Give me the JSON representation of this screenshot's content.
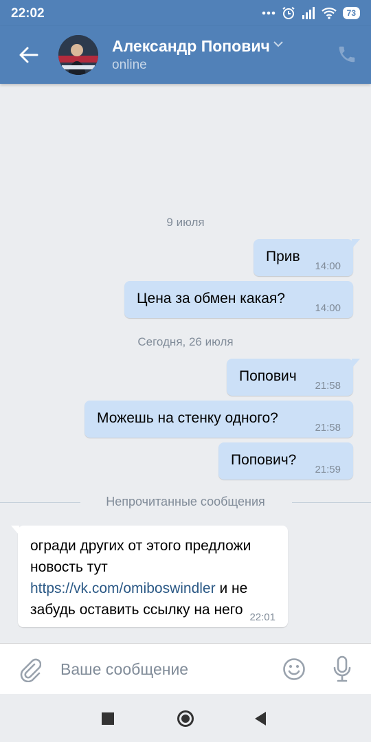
{
  "status_bar": {
    "time": "22:02",
    "battery": "73",
    "icons": [
      "dots-icon",
      "alarm-icon",
      "signal-icon",
      "wifi-icon",
      "battery-icon"
    ]
  },
  "header": {
    "contact_name": "Александр Попович",
    "status": "online",
    "icons": [
      "back-arrow-icon",
      "chevron-down-icon",
      "phone-icon"
    ]
  },
  "conversation": {
    "date1": "9 июля",
    "date2": "Сегодня, 26 июля",
    "messages_july9": [
      {
        "text": "Прив",
        "time": "14:00"
      },
      {
        "text": "Цена за обмен какая?",
        "time": "14:00"
      }
    ],
    "messages_today": [
      {
        "text": "Попович",
        "time": "21:58"
      },
      {
        "text": "Можешь на стенку одного?",
        "time": "21:58"
      },
      {
        "text": "Попович?",
        "time": "21:59"
      }
    ],
    "unread_label": "Непрочитанные сообщения",
    "incoming": {
      "text_before": "огради других от этого предложи новость тут ",
      "link": "https://vk.com/omiboswindler",
      "text_after": " и не забудь оставить ссылку на него",
      "time": "22:01"
    }
  },
  "composer": {
    "placeholder": "Ваше сообщение",
    "icons": [
      "paperclip-icon",
      "emoji-icon",
      "microphone-icon"
    ]
  },
  "colors": {
    "header": "#5181b8",
    "outgoing_bubble": "#cce0f7",
    "incoming_bubble": "#ffffff",
    "background": "#ebedf0",
    "link": "#2a5885"
  }
}
